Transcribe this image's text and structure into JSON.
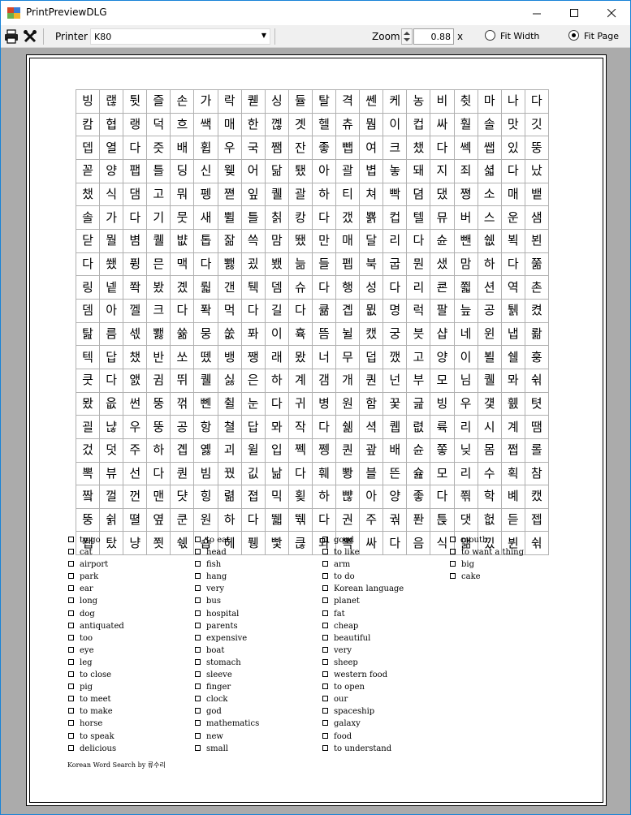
{
  "window": {
    "title": "PrintPreviewDLG"
  },
  "toolbar": {
    "printer_label": "Printer",
    "printer_value": "K80",
    "zoom_label": "Zoom",
    "zoom_value": "0.88",
    "zoom_suffix": "x",
    "fit_width_label": "Fit Width",
    "fit_page_label": "Fit Page",
    "selected_mode": "Fit Page",
    "icons": [
      "printer-icon",
      "tools-icon"
    ]
  },
  "puzzle": {
    "rows": [
      [
        "빙",
        "랞",
        "튓",
        "즐",
        "손",
        "가",
        "락",
        "퀟",
        "싱",
        "듈",
        "탈",
        "격",
        "쏀",
        "케",
        "농",
        "비",
        "췻",
        "마",
        "나",
        "다"
      ],
      [
        "캄",
        "협",
        "랭",
        "덕",
        "흐",
        "쌕",
        "매",
        "한",
        "꼖",
        "곗",
        "헬",
        "츄",
        "뭠",
        "이",
        "컵",
        "싸",
        "훨",
        "솔",
        "맛",
        "깃"
      ],
      [
        "뎁",
        "열",
        "다",
        "즛",
        "배",
        "휩",
        "우",
        "국",
        "쨈",
        "잔",
        "좋",
        "뺍",
        "여",
        "크",
        "챘",
        "다",
        "쎅",
        "쌥",
        "있",
        "뚱"
      ],
      [
        "꼳",
        "양",
        "팹",
        "틀",
        "딩",
        "신",
        "웾",
        "어",
        "닮",
        "퇬",
        "아",
        "괄",
        "볍",
        "놓",
        "돼",
        "지",
        "죄",
        "셟",
        "다",
        "났"
      ],
      [
        "챘",
        "식",
        "댐",
        "고",
        "뭐",
        "펭",
        "쪋",
        "잎",
        "퀠",
        "괄",
        "하",
        "티",
        "쳐",
        "빡",
        "뎜",
        "댔",
        "쪙",
        "소",
        "매",
        "뱉"
      ],
      [
        "솔",
        "가",
        "다",
        "기",
        "뭇",
        "새",
        "쀨",
        "틀",
        "칡",
        "캉",
        "다",
        "갰",
        "뾹",
        "컵",
        "텔",
        "뮤",
        "버",
        "스",
        "운",
        "샘"
      ],
      [
        "닫",
        "뭘",
        "볌",
        "퀠",
        "뱞",
        "톱",
        "잚",
        "쓱",
        "맘",
        "뙜",
        "만",
        "매",
        "달",
        "리",
        "다",
        "슌",
        "뺀",
        "쉢",
        "뵉",
        "뵌"
      ],
      [
        "다",
        "쐤",
        "퓡",
        "믄",
        "맥",
        "다",
        "뾇",
        "굈",
        "뵀",
        "늚",
        "들",
        "펩",
        "북",
        "굽",
        "뭔",
        "샜",
        "맘",
        "하",
        "다",
        "쭒"
      ],
      [
        "링",
        "넽",
        "쫙",
        "봤",
        "곘",
        "뤏",
        "갠",
        "퉥",
        "뎀",
        "슈",
        "다",
        "행",
        "성",
        "다",
        "리",
        "쿈",
        "쬛",
        "션",
        "역",
        "촌"
      ],
      [
        "뎀",
        "아",
        "껠",
        "크",
        "다",
        "퐉",
        "먹",
        "다",
        "길",
        "다",
        "큚",
        "곕",
        "뮚",
        "명",
        "럭",
        "팔",
        "늪",
        "공",
        "퉭",
        "켰"
      ],
      [
        "탎",
        "름",
        "섻",
        "뾇",
        "쓞",
        "뭉",
        "쑶",
        "퐈",
        "이",
        "휵",
        "뜸",
        "뉠",
        "캤",
        "궁",
        "븟",
        "샵",
        "네",
        "윈",
        "냅",
        "뢂"
      ],
      [
        "텍",
        "답",
        "챘",
        "반",
        "쏘",
        "뗐",
        "뱅",
        "쨍",
        "래",
        "뫘",
        "너",
        "무",
        "덥",
        "깼",
        "고",
        "양",
        "이",
        "뵐",
        "쉘",
        "훙"
      ],
      [
        "쿳",
        "다",
        "앬",
        "귐",
        "뛰",
        "퀠",
        "싫",
        "은",
        "하",
        "계",
        "갬",
        "개",
        "퀀",
        "넌",
        "부",
        "모",
        "님",
        "퀠",
        "뫄",
        "쉮"
      ],
      [
        "뫘",
        "읎",
        "썬",
        "뚱",
        "꺾",
        "뼨",
        "췰",
        "눈",
        "다",
        "귀",
        "병",
        "원",
        "함",
        "꿎",
        "긆",
        "빙",
        "우",
        "걫",
        "휈",
        "텻"
      ],
      [
        "괼",
        "냖",
        "우",
        "뚱",
        "공",
        "항",
        "쳘",
        "답",
        "뫄",
        "작",
        "다",
        "쉚",
        "셕",
        "퀩",
        "렶",
        "륙",
        "리",
        "시",
        "계",
        "땜"
      ],
      [
        "겄",
        "덧",
        "주",
        "하",
        "곕",
        "옗",
        "괴",
        "윌",
        "입",
        "쩩",
        "쩽",
        "퀀",
        "괖",
        "배",
        "슌",
        "쫗",
        "닞",
        "몸",
        "쩝",
        "롤"
      ],
      [
        "뽁",
        "뷰",
        "선",
        "다",
        "퀀",
        "빔",
        "꿨",
        "깂",
        "낢",
        "다",
        "훼",
        "뽱",
        "블",
        "뜬",
        "슖",
        "모",
        "리",
        "수",
        "획",
        "참"
      ],
      [
        "짴",
        "껄",
        "껀",
        "맨",
        "댯",
        "힝",
        "렮",
        "졉",
        "믹",
        "횢",
        "하",
        "뺞",
        "아",
        "양",
        "좋",
        "다",
        "쬒",
        "학",
        "볘",
        "캤"
      ],
      [
        "뚱",
        "쉵",
        "뗠",
        "옆",
        "쿤",
        "원",
        "하",
        "다",
        "뛟",
        "뛖",
        "다",
        "권",
        "주",
        "궊",
        "퐌",
        "튽",
        "댓",
        "헚",
        "듣",
        "젭"
      ],
      [
        "쬅",
        "탔",
        "냥",
        "쬣",
        "쉓",
        "숍",
        "헤",
        "퓅",
        "빷",
        "큲",
        "뫄",
        "뽁",
        "싸",
        "다",
        "음",
        "식",
        "앪",
        "낐",
        "뷘",
        "쉮"
      ]
    ],
    "word_columns": [
      [
        "to go",
        "cat",
        "airport",
        "park",
        "ear",
        "long",
        "dog",
        "antiquated",
        "too",
        "eye",
        "leg",
        "to close",
        "pig",
        "to meet",
        "to make",
        "horse",
        "to speak",
        "delicious"
      ],
      [
        "to eat",
        "head",
        "fish",
        "hang",
        "very",
        "bus",
        "hospital",
        "parents",
        "expensive",
        "boat",
        "stomach",
        "sleeve",
        "finger",
        "clock",
        "god",
        "mathematics",
        "new",
        "small"
      ],
      [
        "good",
        "to like",
        "arm",
        "to do",
        "Korean language",
        "planet",
        "fat",
        "cheap",
        "beautiful",
        "very",
        "sheep",
        "western food",
        "to open",
        "our",
        "spaceship",
        "galaxy",
        "food",
        "to understand"
      ],
      [
        "mouth",
        "to want a thing",
        "big",
        "cake"
      ]
    ],
    "footer": "Korean Word Search by 류수리"
  }
}
